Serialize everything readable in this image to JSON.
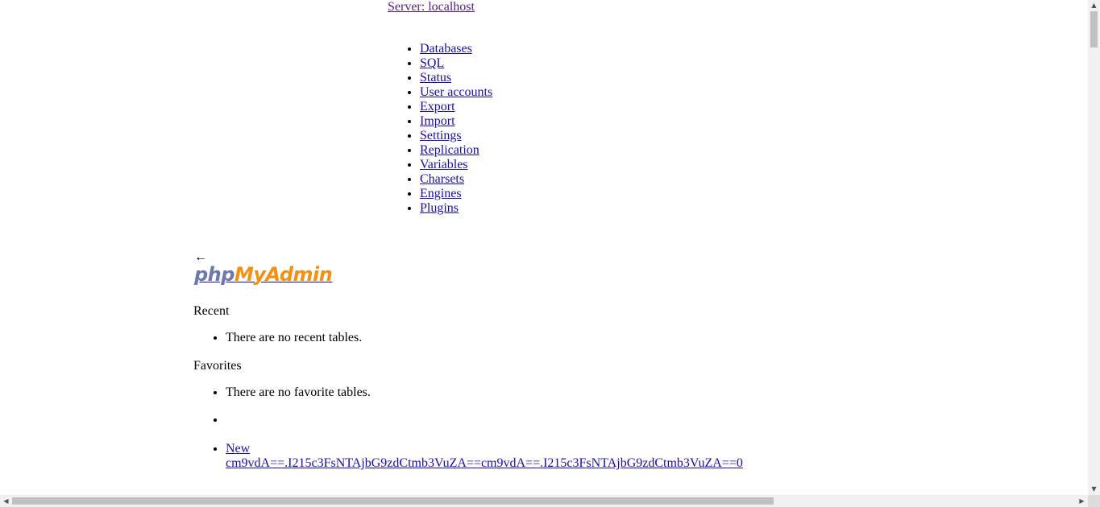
{
  "header": {
    "server_link": "Server: localhost"
  },
  "menu": {
    "items": [
      {
        "label": " Databases"
      },
      {
        "label": " SQL"
      },
      {
        "label": " Status"
      },
      {
        "label": " User accounts"
      },
      {
        "label": " Export"
      },
      {
        "label": " Import"
      },
      {
        "label": " Settings"
      },
      {
        "label": " Replication"
      },
      {
        "label": " Variables"
      },
      {
        "label": " Charsets"
      },
      {
        "label": " Engines"
      },
      {
        "label": " Plugins"
      }
    ]
  },
  "navigation": {
    "back_arrow": "←",
    "logo": {
      "part1": "php",
      "part2": "MyAdmin"
    },
    "recent": {
      "title": "Recent",
      "empty_text": "There are no recent tables."
    },
    "favorites": {
      "title": "Favorites",
      "empty_text": "There are no favorite tables.",
      "new_label": "New",
      "db_link": "cm9vdA==.I215c3FsNTAjbG9zdCtmb3VuZA==cm9vdA==.I215c3FsNTAjbG9zdCtmb3VuZA==0"
    }
  },
  "colors": {
    "link": "#1a0dab",
    "visited_link": "#551a8b",
    "logo_php": "#6c78af",
    "logo_myadmin": "#f29111"
  }
}
